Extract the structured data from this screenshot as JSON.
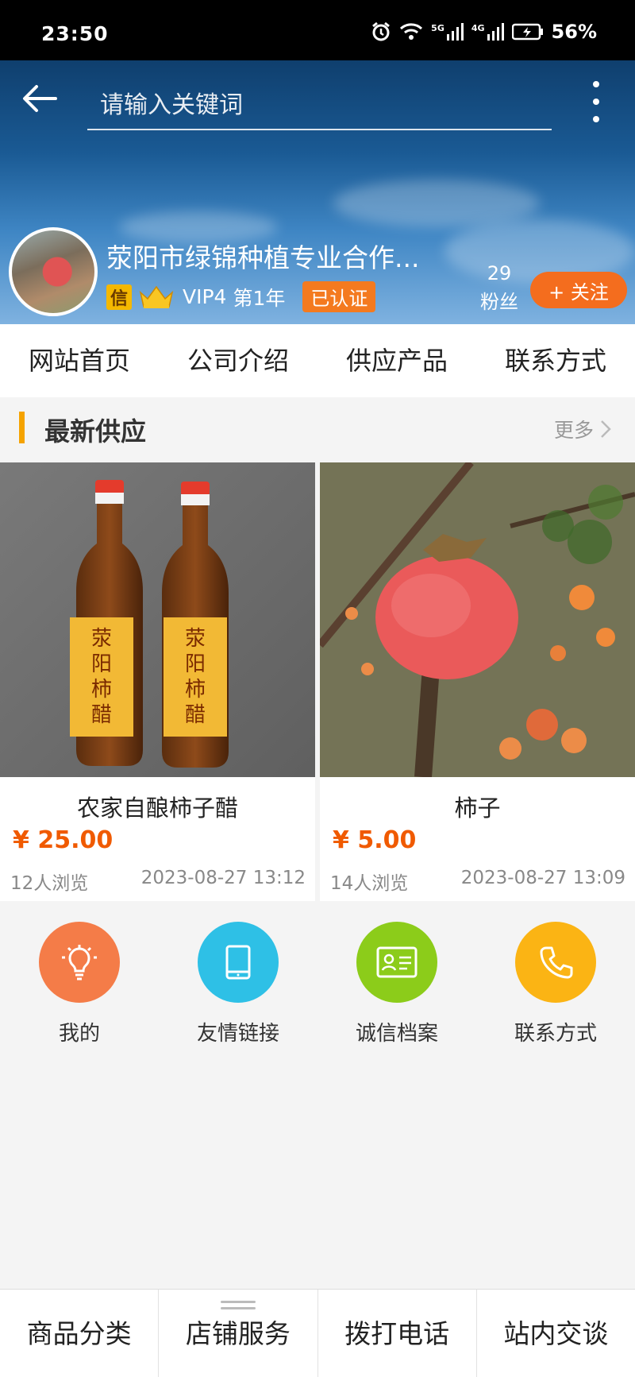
{
  "status_bar": {
    "time": "23:50",
    "signal1": "5G",
    "signal2": "4G",
    "battery": "56%"
  },
  "header": {
    "search_placeholder": "请输入关键词",
    "company_name": "荥阳市绿锦种植专业合作...",
    "xin_badge": "信",
    "vip": "VIP4",
    "year": "第1年",
    "verified": "已认证",
    "fans_count": "29",
    "fans_label": "粉丝",
    "follow_label": "+ 关注"
  },
  "nav": {
    "tabs": [
      "网站首页",
      "公司介绍",
      "供应产品",
      "联系方式"
    ]
  },
  "section": {
    "title": "最新供应",
    "more": "更多"
  },
  "products": [
    {
      "name": "农家自酿柿子醋",
      "price": "¥ 25.00",
      "views": "12人浏览",
      "date": "2023-08-27 13:12",
      "bottle_label": "荥阳柿醋"
    },
    {
      "name": "柿子",
      "price": "¥ 5.00",
      "views": "14人浏览",
      "date": "2023-08-27 13:09"
    }
  ],
  "quick_links": [
    {
      "label": "我的",
      "icon": "lightbulb-icon",
      "color": "#f47c48"
    },
    {
      "label": "友情链接",
      "icon": "tablet-icon",
      "color": "#2ec0e6"
    },
    {
      "label": "诚信档案",
      "icon": "id-card-icon",
      "color": "#8ccc1a"
    },
    {
      "label": "联系方式",
      "icon": "phone-icon",
      "color": "#fbb414"
    }
  ],
  "bottom_bar": [
    "商品分类",
    "店铺服务",
    "拨打电话",
    "站内交谈"
  ],
  "colors": {
    "accent": "#f46d1e",
    "price": "#f05a00",
    "section_bar": "#f5a300"
  }
}
